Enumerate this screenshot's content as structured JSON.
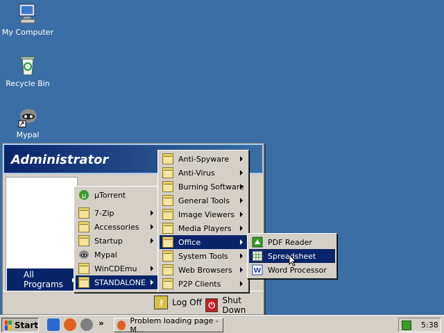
{
  "desktop": {
    "icons": [
      {
        "label": "My Computer"
      },
      {
        "label": "Recycle Bin"
      },
      {
        "label": "Mypal"
      }
    ]
  },
  "start_menu": {
    "user": "Administrator",
    "all_programs": "All Programs",
    "log_off": "Log Off",
    "shut_down": "Shut Down"
  },
  "programs_menu": {
    "items": [
      {
        "label": "µTorrent",
        "icon": "utorrent-icon"
      },
      {
        "label": "7-Zip",
        "icon": "folder-icon",
        "submenu": true
      },
      {
        "label": "Accessories",
        "icon": "folder-icon",
        "submenu": true
      },
      {
        "label": "Startup",
        "icon": "folder-icon",
        "submenu": true
      },
      {
        "label": "Mypal",
        "icon": "mypal-icon"
      },
      {
        "label": "WinCDEmu",
        "icon": "folder-icon",
        "submenu": true
      },
      {
        "label": "STANDALONE",
        "icon": "folder-icon",
        "submenu": true,
        "selected": true
      }
    ]
  },
  "standalone_menu": {
    "items": [
      {
        "label": "Anti-Spyware"
      },
      {
        "label": "Anti-Virus"
      },
      {
        "label": "Burning Software"
      },
      {
        "label": "General Tools"
      },
      {
        "label": "Image Viewers"
      },
      {
        "label": "Media Players"
      },
      {
        "label": "Office",
        "selected": true
      },
      {
        "label": "System Tools"
      },
      {
        "label": "Web Browsers"
      },
      {
        "label": "P2P Clients"
      }
    ]
  },
  "office_menu": {
    "items": [
      {
        "label": "PDF Reader",
        "icon": "pdf-reader-icon"
      },
      {
        "label": "Spreadsheet",
        "icon": "spreadsheet-icon",
        "selected": true
      },
      {
        "label": "Word Processor",
        "icon": "word-processor-icon"
      }
    ]
  },
  "taskbar": {
    "start_label": "Start",
    "more_label": "»",
    "task_label": "Problem loading page - M...",
    "clock": "5:38"
  },
  "colors": {
    "desktop": "#3a6ea5",
    "selection": "#0a246a",
    "face": "#d4d0c8"
  }
}
